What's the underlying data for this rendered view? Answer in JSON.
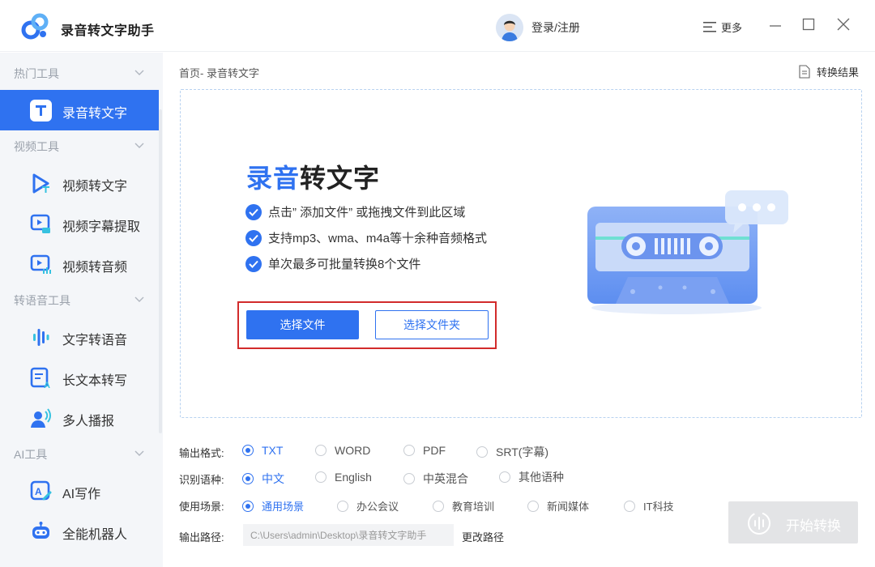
{
  "app": {
    "title": "录音转文字助手"
  },
  "header": {
    "login_label": "登录/注册",
    "more_label": "更多"
  },
  "sidebar": {
    "groups": [
      {
        "title": "热门工具",
        "items": [
          {
            "label": "录音转文字",
            "icon": "text-t-icon",
            "active": true
          }
        ]
      },
      {
        "title": "视频工具",
        "items": [
          {
            "label": "视频转文字",
            "icon": "video-to-text-icon"
          },
          {
            "label": "视频字幕提取",
            "icon": "subtitle-extract-icon"
          },
          {
            "label": "视频转音频",
            "icon": "video-to-audio-icon"
          }
        ]
      },
      {
        "title": "转语音工具",
        "items": [
          {
            "label": "文字转语音",
            "icon": "sound-wave-icon"
          },
          {
            "label": "长文本转写",
            "icon": "long-text-icon"
          },
          {
            "label": "多人播报",
            "icon": "multi-speaker-icon"
          }
        ]
      },
      {
        "title": "AI工具",
        "items": [
          {
            "label": "AI写作",
            "icon": "ai-writing-icon"
          },
          {
            "label": "全能机器人",
            "icon": "robot-icon"
          }
        ]
      }
    ]
  },
  "main": {
    "breadcrumb": "首页- 录音转文字",
    "result_link": "转换结果",
    "hero": {
      "title_blue": "录音",
      "title_rest": "转文字",
      "features": [
        "点击” 添加文件” 或拖拽文件到此区域",
        "支持mp3、wma、m4a等十余种音频格式",
        "单次最多可批量转换8个文件"
      ],
      "select_file": "选择文件",
      "select_folder": "选择文件夹"
    },
    "options": {
      "format": {
        "label": "输出格式:",
        "choices": [
          "TXT",
          "WORD",
          "PDF",
          "SRT(字幕)"
        ],
        "selected": "TXT"
      },
      "language": {
        "label": "识别语种:",
        "choices": [
          "中文",
          "English",
          "中英混合",
          "其他语种"
        ],
        "selected": "中文"
      },
      "scene": {
        "label": "使用场景:",
        "choices": [
          "通用场景",
          "办公会议",
          "教育培训",
          "新闻媒体",
          "IT科技"
        ],
        "selected": "通用场景"
      },
      "path": {
        "label": "输出路径:",
        "value": "C:\\Users\\admin\\Desktop\\录音转文字助手",
        "change_label": "更改路径"
      }
    },
    "start_label": "开始转换"
  },
  "colors": {
    "accent": "#2f72f0",
    "highlight_frame": "#d22b2b",
    "sidebar_bg": "#f4f6f9",
    "disabled_btn": "#e3e4e6"
  }
}
